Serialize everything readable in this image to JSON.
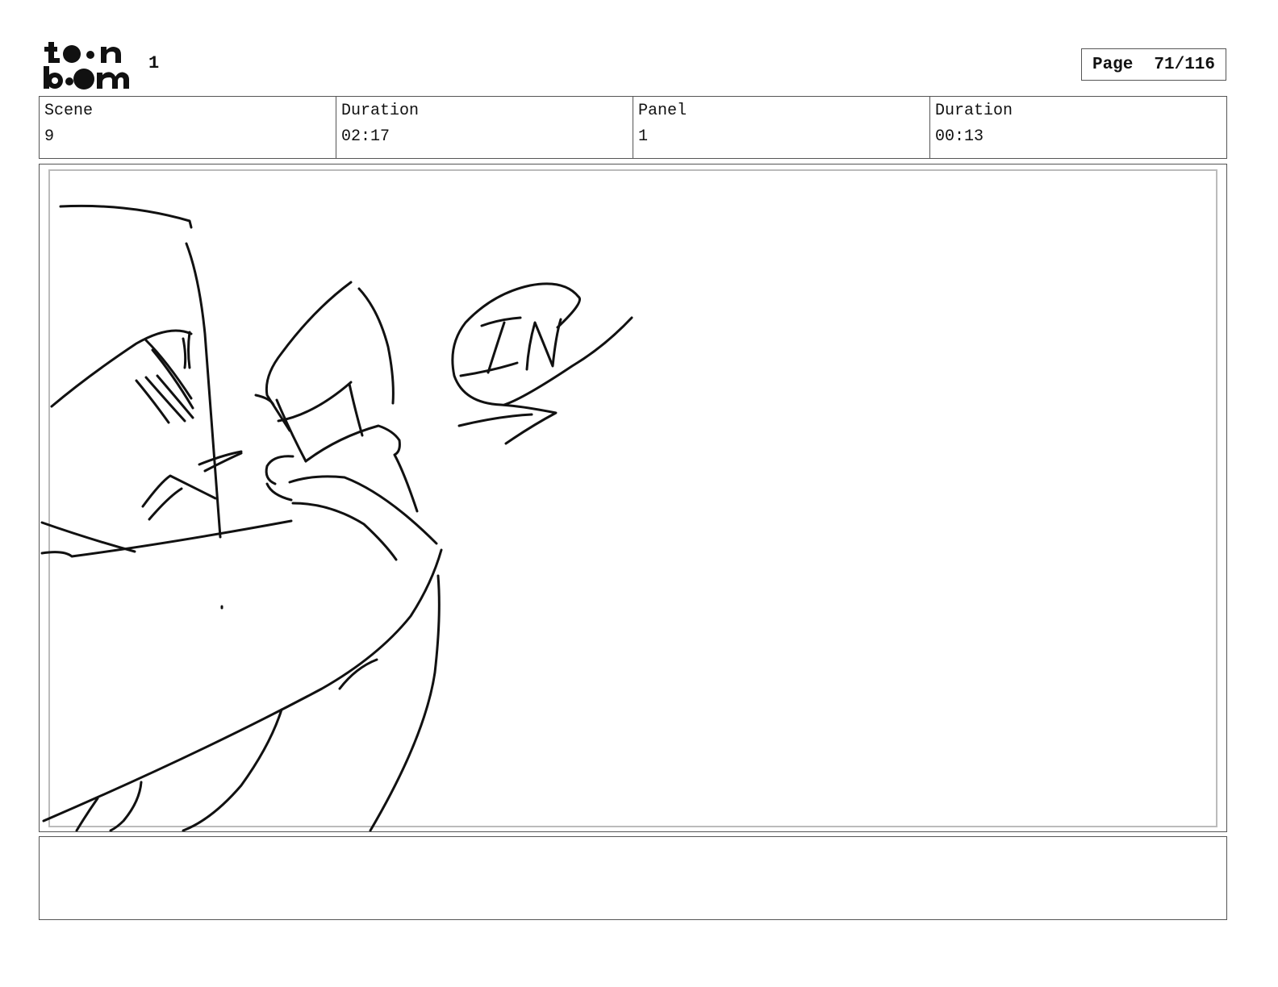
{
  "brand": {
    "logo_text": "toon boom"
  },
  "header": {
    "number": "1",
    "page_label": "Page",
    "page_value": "71/116"
  },
  "info": [
    {
      "label": "Scene",
      "value": "9"
    },
    {
      "label": "Duration",
      "value": "02:17"
    },
    {
      "label": "Panel",
      "value": "1"
    },
    {
      "label": "Duration",
      "value": "00:13"
    }
  ],
  "sketch": {
    "caption_text": "IN"
  },
  "notes": {
    "text": ""
  }
}
